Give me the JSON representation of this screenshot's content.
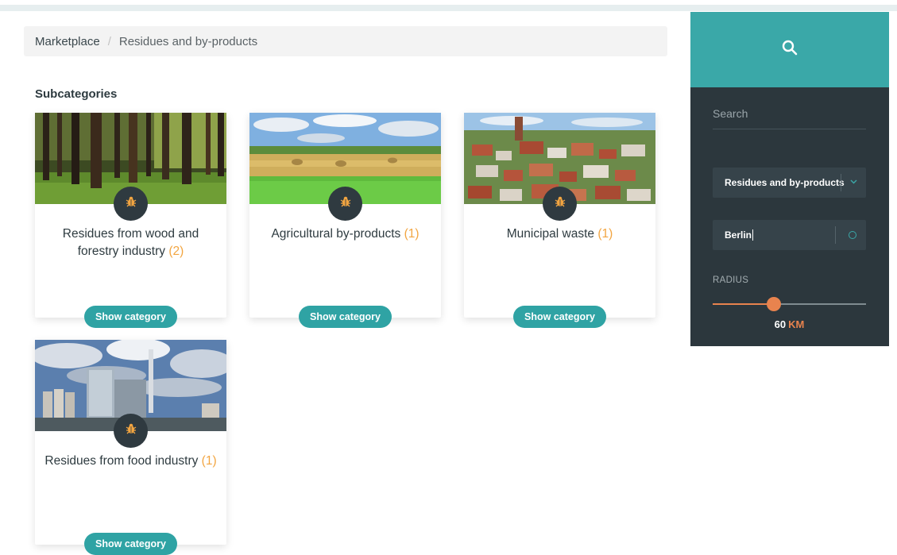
{
  "breadcrumb": {
    "items": [
      "Marketplace",
      "Residues and by-products"
    ],
    "separator": "/"
  },
  "section_title": "Subcategories",
  "cards": [
    {
      "title": "Residues from wood and forestry industry",
      "count": "(2)",
      "button": "Show category",
      "image": "forest"
    },
    {
      "title": "Agricultural by-products",
      "count": "(1)",
      "button": "Show category",
      "image": "field"
    },
    {
      "title": "Municipal waste",
      "count": "(1)",
      "button": "Show category",
      "image": "town"
    },
    {
      "title": "Residues from food industry",
      "count": "(1)",
      "button": "Show category",
      "image": "factory"
    }
  ],
  "badge_icon": "bug-icon",
  "sidebar": {
    "search_icon": "search-icon",
    "search_placeholder": "Search",
    "category_select": "Residues and by-products",
    "location_value": "Berlin",
    "radius_label": "RADIUS",
    "radius_value": "60",
    "radius_unit": "KM",
    "radius_fraction": 0.4
  },
  "colors": {
    "teal": "#3aa8a8",
    "button_teal": "#2fa3a4",
    "panel_dark": "#2c373d",
    "accent_orange": "#e8834e",
    "count_orange": "#f2a541"
  }
}
